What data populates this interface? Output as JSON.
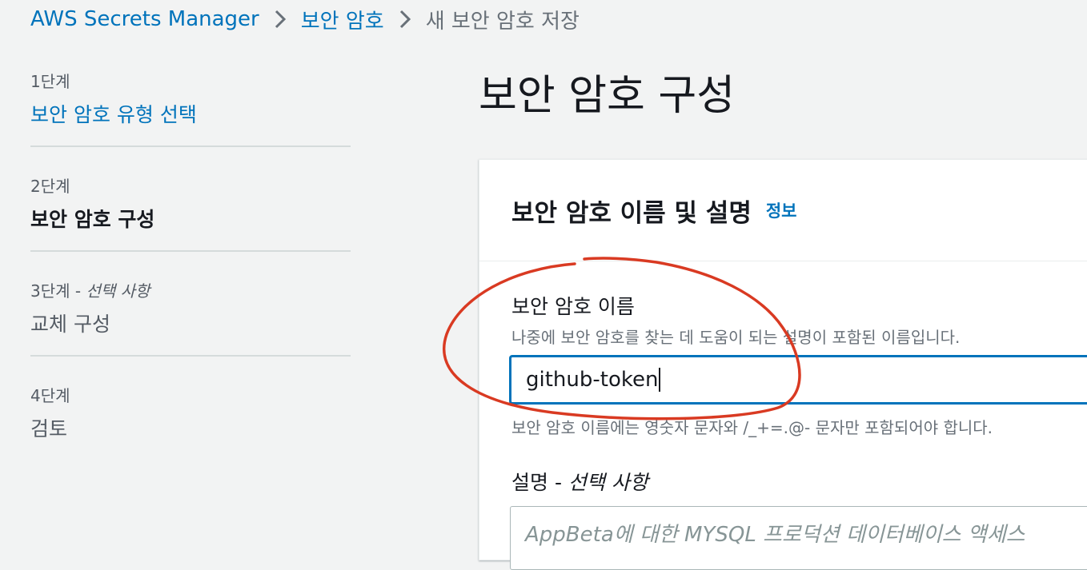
{
  "breadcrumb": {
    "items": [
      {
        "label": "AWS Secrets Manager"
      },
      {
        "label": "보안 암호"
      }
    ],
    "current": "새 보안 암호 저장"
  },
  "steps": [
    {
      "number": "1단계",
      "optional": "",
      "title": "보안 암호 유형 선택",
      "state": "completed"
    },
    {
      "number": "2단계",
      "optional": "",
      "title": "보안 암호 구성",
      "state": "current"
    },
    {
      "number": "3단계 - ",
      "optional": "선택 사항",
      "title": "교체 구성",
      "state": "upcoming"
    },
    {
      "number": "4단계",
      "optional": "",
      "title": "검토",
      "state": "upcoming"
    }
  ],
  "page_title": "보안 암호 구성",
  "section": {
    "title": "보안 암호 이름 및 설명",
    "info_link": "정보"
  },
  "secret_name": {
    "label": "보안 암호 이름",
    "description": "나중에 보안 암호를 찾는 데 도움이 되는 설명이 포함된 이름입니다.",
    "value": "github-token",
    "constraint": "보안 암호 이름에는 영숫자 문자와 /_+=.@- 문자만 포함되어야 합니다."
  },
  "description_field": {
    "label": "설명 - ",
    "optional": "선택 사항",
    "placeholder": "AppBeta에 대한 MYSQL 프로덕션 데이터베이스 액세스"
  },
  "colors": {
    "link": "#0073bb",
    "annotation": "#d93a22",
    "background": "#f2f3f3"
  }
}
